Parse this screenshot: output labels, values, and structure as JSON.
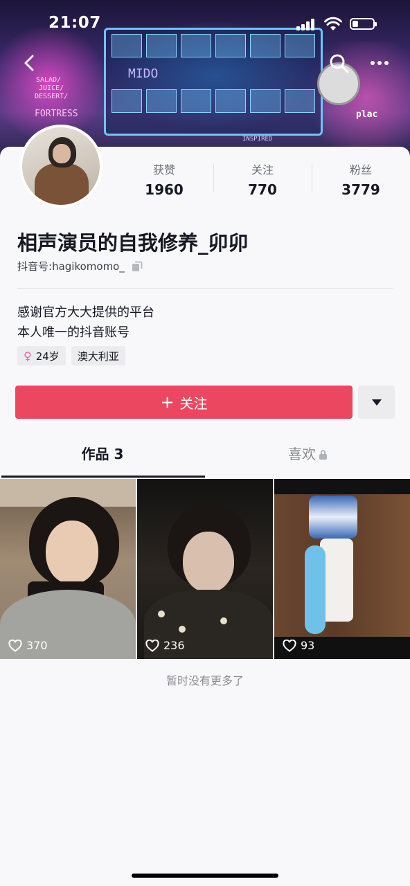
{
  "status_bar": {
    "time": "21:07"
  },
  "banner": {
    "signs": [
      "SALAD/",
      "JUICE/",
      "DESSERT/",
      "FORTRESS",
      "MIDO",
      "INSPIRED",
      "plac"
    ]
  },
  "profile": {
    "nickname": "相声演员的自我修养_卯卯",
    "douyin_id_label": "抖音号: ",
    "douyin_id": "hagikomomo_",
    "bio_lines": [
      "感谢官方大大提供的平台",
      "本人唯一的抖音账号"
    ],
    "tags": {
      "age": "24岁",
      "age_symbol": "♀",
      "location": "澳大利亚"
    }
  },
  "stats": [
    {
      "label": "获赞",
      "value": "1960"
    },
    {
      "label": "关注",
      "value": "770"
    },
    {
      "label": "粉丝",
      "value": "3779"
    }
  ],
  "actions": {
    "follow_plus": "+",
    "follow_label": "关注"
  },
  "tabs": {
    "works": "作品 3",
    "likes": "喜欢"
  },
  "videos": [
    {
      "likes": "370"
    },
    {
      "likes": "236"
    },
    {
      "likes": "93"
    }
  ],
  "footer": {
    "no_more": "暂时没有更多了"
  },
  "colors": {
    "follow_button": "#ec4760",
    "female_symbol": "#f05ea1"
  }
}
